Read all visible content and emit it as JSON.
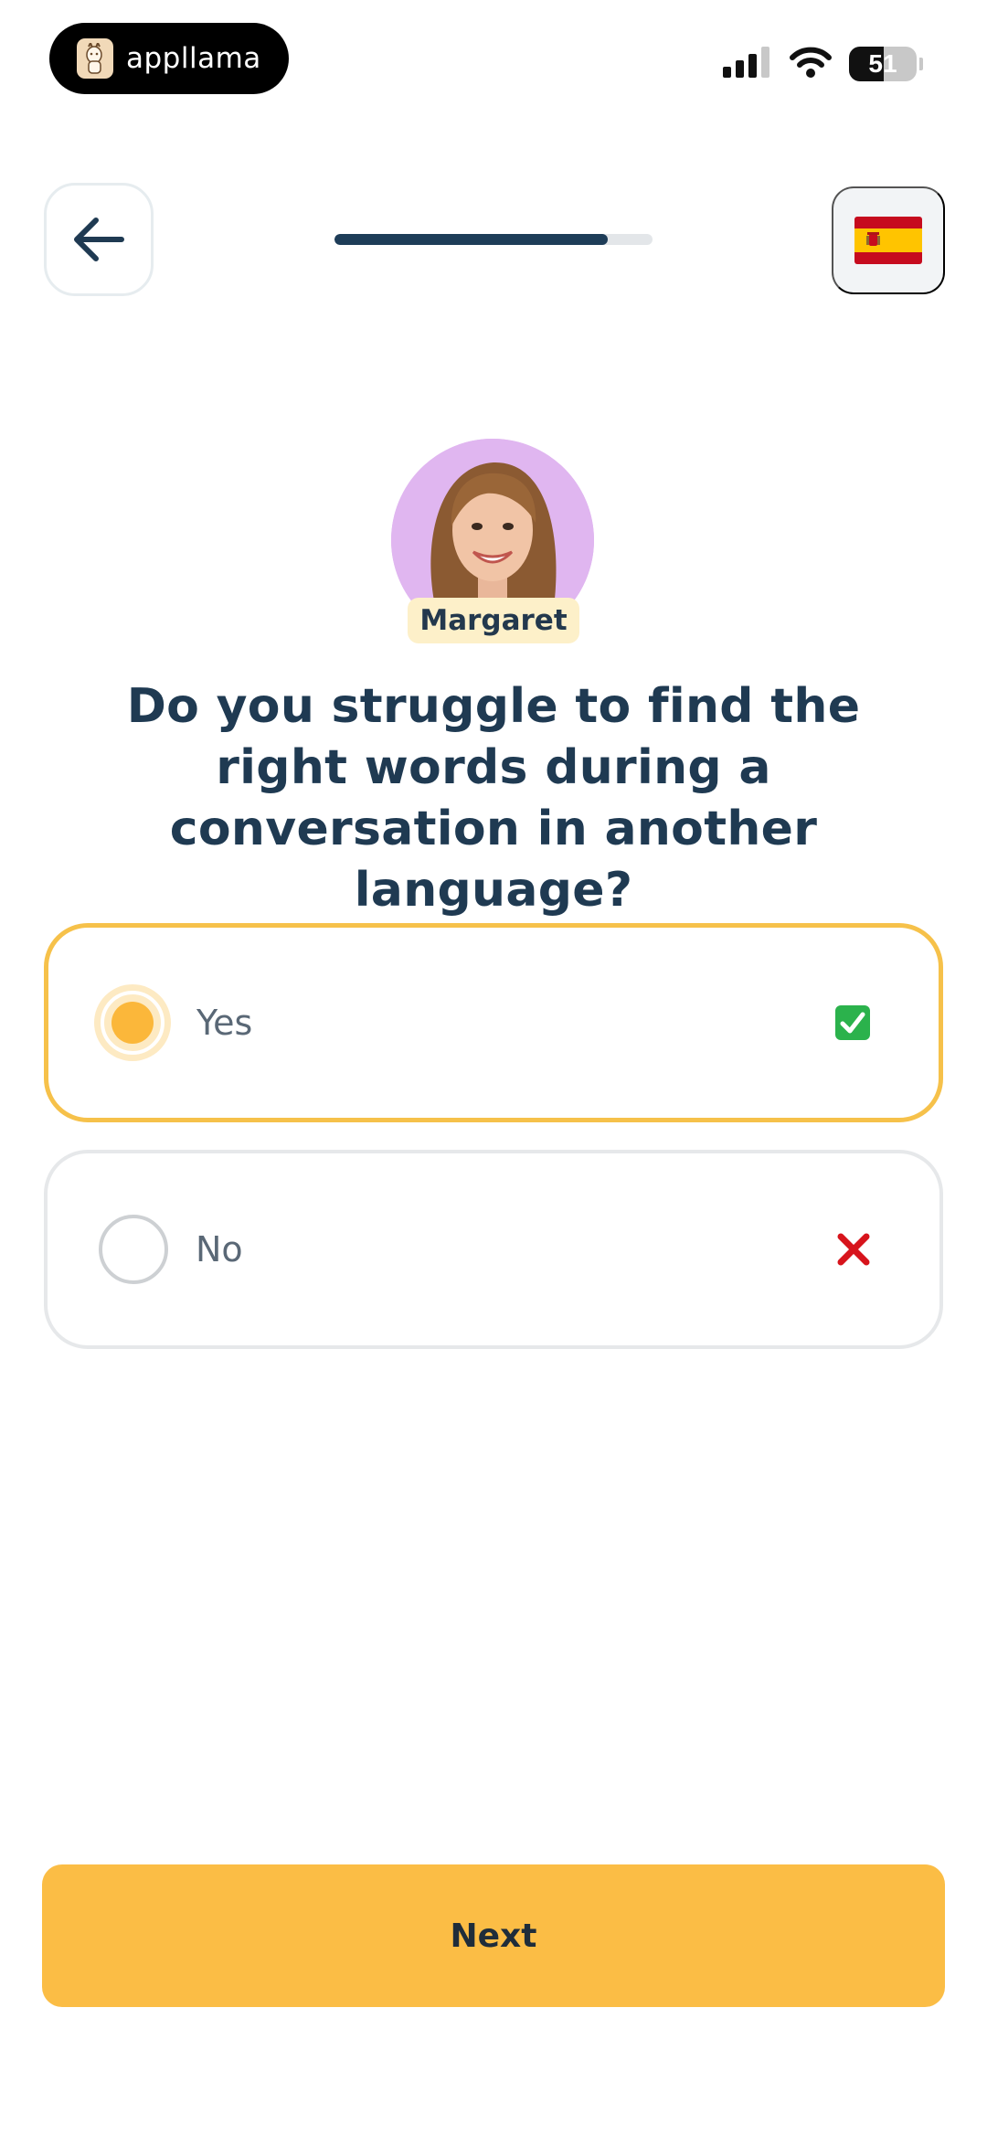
{
  "status_bar": {
    "app_name": "appllama",
    "battery": "51",
    "battery_level": 0.51
  },
  "header": {
    "progress": 0.86,
    "language_flag": "spain-flag-icon"
  },
  "tutor": {
    "name": "Margaret"
  },
  "question": "Do you struggle to find the right words during a conversation in another language?",
  "options": [
    {
      "label": "Yes",
      "icon": "green-check-icon",
      "selected": true
    },
    {
      "label": "No",
      "icon": "red-x-icon",
      "selected": false
    }
  ],
  "actions": {
    "next_label": "Next"
  },
  "colors": {
    "accent": "#fbbd45",
    "selected_border": "#f6c14a",
    "text_dark": "#1f3a52",
    "progress": "#1e3d58"
  }
}
